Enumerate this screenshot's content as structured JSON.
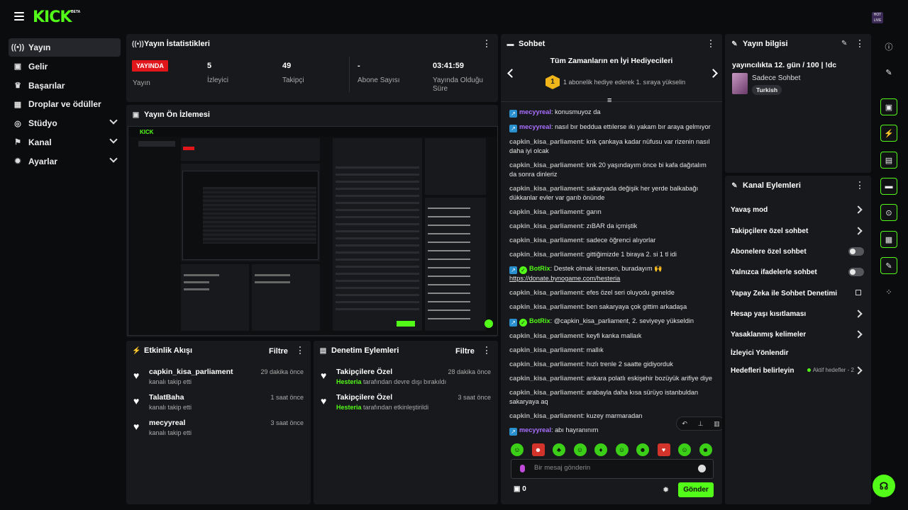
{
  "brand": {
    "logo": "KICK",
    "beta": "BETA",
    "accent": "#53fc18"
  },
  "top": {
    "avatar_label": "HOT LIVE"
  },
  "nav": {
    "items": [
      {
        "label": "Yayın",
        "icon": "broadcast-icon"
      },
      {
        "label": "Gelir",
        "icon": "money-icon"
      },
      {
        "label": "Başarılar",
        "icon": "trophy-icon"
      },
      {
        "label": "Droplar ve ödüller",
        "icon": "gift-icon"
      },
      {
        "label": "Stüdyo",
        "icon": "studio-icon"
      },
      {
        "label": "Kanal",
        "icon": "channel-icon"
      },
      {
        "label": "Ayarlar",
        "icon": "gear-icon"
      }
    ]
  },
  "stats": {
    "title": "Yayın İstatistikleri",
    "live_badge": "YAYINDA",
    "items": [
      {
        "value": "",
        "label": "Yayın"
      },
      {
        "value": "5",
        "label": "İzleyici"
      },
      {
        "value": "49",
        "label": "Takipçi"
      },
      {
        "value": "-",
        "label": "Abone Sayısı"
      },
      {
        "value": "03:41:59",
        "label": "Yayında Olduğu Süre"
      }
    ]
  },
  "preview": {
    "title": "Yayın Ön İzlemesi"
  },
  "activity": {
    "title": "Etkinlik Akışı",
    "filter": "Filtre",
    "rows": [
      {
        "name": "capkin_kisa_parliament",
        "sub": "kanalı takip etti",
        "time": "29 dakika önce"
      },
      {
        "name": "TalatBaha",
        "sub": "kanalı takip etti",
        "time": "1 saat önce"
      },
      {
        "name": "mecyyreal",
        "sub": "kanalı takip etti",
        "time": "3 saat önce"
      }
    ]
  },
  "moderation": {
    "title": "Denetim Eylemleri",
    "filter": "Filtre",
    "rows": [
      {
        "name": "Takipçilere Özel",
        "actor": "Hesteria",
        "sub": "tarafından devre dışı bırakıldı",
        "time": "28 dakika önce"
      },
      {
        "name": "Takipçilere Özel",
        "actor": "Hesteria",
        "sub": "tarafından etkinleştirildi",
        "time": "3 saat önce"
      }
    ]
  },
  "chat": {
    "title": "Sohbet",
    "gifters_title": "Tüm Zamanların en İyi Hediyecileri",
    "gift_rank": "1",
    "gifters_sub": "1 abonelik hediye ederek 1. sıraya yükselin",
    "messages": [
      {
        "user": "mecyyreal",
        "style": "purple",
        "badge": true,
        "text": ": konusmuyoz da"
      },
      {
        "user": "mecyyreal",
        "style": "purple",
        "badge": true,
        "text": ": nasıl bır beddua ettılerse ıkı yakam bır araya gelmıyor"
      },
      {
        "user": "capkin_kisa_parliament",
        "style": "gray",
        "text": ": knk çankaya kadar nüfusu var rizenin nasıl daha iyi olcak"
      },
      {
        "user": "capkin_kisa_parliament",
        "style": "gray",
        "text": ": knk 20 yaşındayım önce bi kafa dağıtalım da sonra dinleriz"
      },
      {
        "user": "capkin_kisa_parliament",
        "style": "gray",
        "text": ": sakaryada değişik her yerde balkabağı dükkanlar evler var garıb önünde"
      },
      {
        "user": "capkin_kisa_parliament",
        "style": "gray",
        "text": ": garın"
      },
      {
        "user": "capkin_kisa_parliament",
        "style": "gray",
        "text": ": zıBAR da içmiştik"
      },
      {
        "user": "capkin_kisa_parliament",
        "style": "gray",
        "text": ": sadece öğrenci alıyorlar"
      },
      {
        "user": "capkin_kisa_parliament",
        "style": "gray",
        "text": ": gittiğimizde 1 biraya 2. si 1 tl idi"
      },
      {
        "user": "BotRix",
        "style": "green",
        "badge": true,
        "bot": true,
        "text": ": Destek olmak istersen, buradayım 🙌 ",
        "link": "https://donate.bynogame.com/hesteria"
      },
      {
        "user": "capkin_kisa_parliament",
        "style": "gray",
        "text": ": efes özel seri oluyodu genelde"
      },
      {
        "user": "capkin_kisa_parliament",
        "style": "gray",
        "text": ": ben sakaryaya çok gittim arkadaşa"
      },
      {
        "user": "BotRix",
        "style": "green",
        "badge": true,
        "bot": true,
        "text": ": @capkin_kisa_parliament, 2. seviyeye yükseldin"
      },
      {
        "user": "capkin_kisa_parliament",
        "style": "gray",
        "text": ": keyfi kanka mallaık"
      },
      {
        "user": "capkin_kisa_parliament",
        "style": "gray",
        "text": ": mallık"
      },
      {
        "user": "capkin_kisa_parliament",
        "style": "gray",
        "text": ": hızlı trenle 2 saatte gidiyorduk"
      },
      {
        "user": "capkin_kisa_parliament",
        "style": "gray",
        "text": ": ankara polatlı eskişehir bozüyük arifiye diye"
      },
      {
        "user": "capkin_kisa_parliament",
        "style": "gray",
        "text": ": arabayla daha kısa sürüyo istanbuldan sakaryaya aq"
      },
      {
        "user": "capkin_kisa_parliament",
        "style": "gray",
        "text": ": kuzey marmaradan"
      },
      {
        "user": "mecyyreal",
        "style": "purple",
        "badge": true,
        "text": ": abı hayranınım"
      }
    ],
    "input_placeholder": "Bir mesaj gönderin",
    "points": "0",
    "send_label": "Gönder"
  },
  "info": {
    "title": "Yayın bilgisi",
    "stream_title": "yayıncılıkta 12. gün / 100 | !dc",
    "category": "Sadece Sohbet",
    "tag": "Turkish"
  },
  "actions": {
    "title": "Kanal Eylemleri",
    "items": [
      {
        "label": "Yavaş mod",
        "kind": "chevron"
      },
      {
        "label": "Takipçilere özel sohbet",
        "kind": "chevron"
      },
      {
        "label": "Abonelere özel sohbet",
        "kind": "toggle"
      },
      {
        "label": "Yalnızca ifadelerle sohbet",
        "kind": "toggle"
      },
      {
        "label": "Yapay Zeka ile Sohbet Denetimi",
        "kind": "external"
      },
      {
        "label": "Hesap yaşı kısıtlaması",
        "kind": "chevron"
      },
      {
        "label": "Yasaklanmış kelimeler",
        "kind": "chevron"
      },
      {
        "label": "İzleyici Yönlendir",
        "kind": "none"
      },
      {
        "label": "Hedefleri belirleyin",
        "kind": "chevron",
        "note": "Aktif hedefler - 2"
      }
    ]
  }
}
